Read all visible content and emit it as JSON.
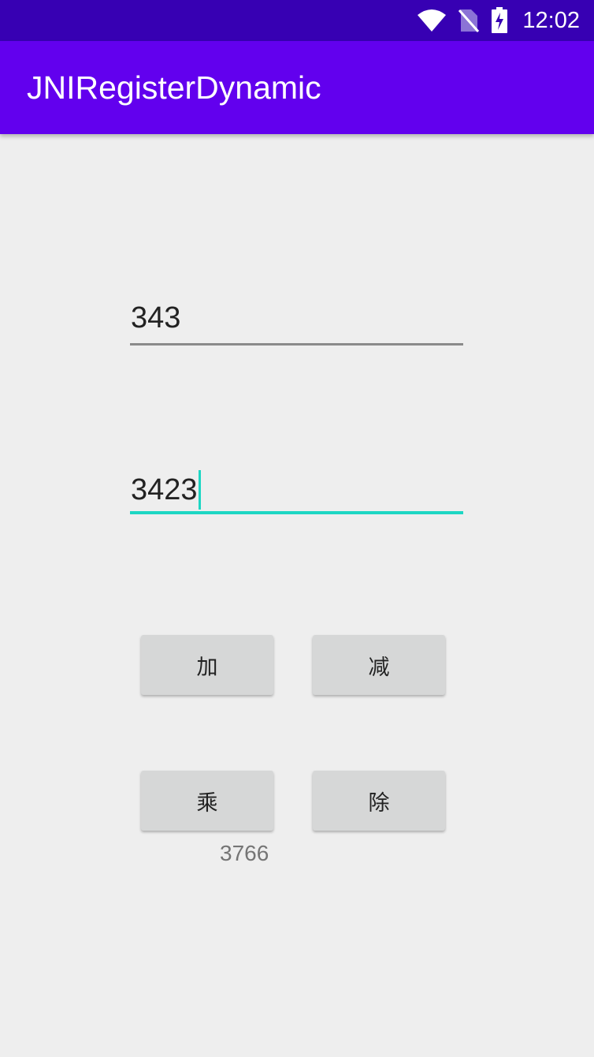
{
  "status_bar": {
    "time": "12:02",
    "icons": [
      "wifi-icon",
      "no-sim-icon",
      "battery-charging-icon"
    ],
    "background": "#3700b3"
  },
  "app_bar": {
    "title": "JNIRegisterDynamic",
    "background": "#6200ee"
  },
  "inputs": {
    "first_value": "343",
    "second_value": "3423",
    "focus_color": "#1dd6c3"
  },
  "buttons": {
    "add": "加",
    "subtract": "减",
    "multiply": "乘",
    "divide": "除"
  },
  "result": {
    "value": "3766"
  }
}
